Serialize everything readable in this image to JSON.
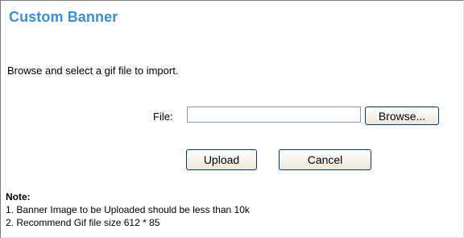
{
  "title": "Custom Banner",
  "instruction": "Browse and select a gif file to import.",
  "file": {
    "label": "File:",
    "value": "",
    "placeholder": ""
  },
  "buttons": {
    "browse": "Browse...",
    "upload": "Upload",
    "cancel": "Cancel"
  },
  "note": {
    "heading": "Note:",
    "lines": [
      "1. Banner Image to be Uploaded should be less than 10k",
      "2. Recommend Gif file size 612 * 85"
    ]
  },
  "colors": {
    "title": "#3a8fd8",
    "button_border": "#003c74",
    "input_border": "#7f9db9"
  }
}
